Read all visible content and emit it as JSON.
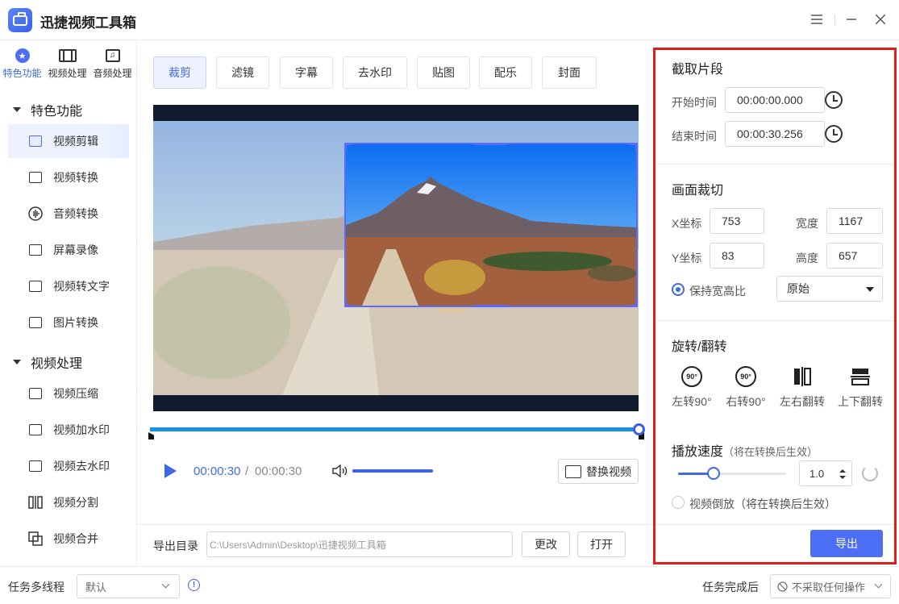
{
  "app": {
    "title": "迅捷视频工具箱",
    "window_controls": [
      "menu-icon",
      "minimize-icon",
      "close-icon"
    ]
  },
  "sidebar": {
    "mode_tabs": [
      {
        "label": "特色功能",
        "icon": "star-icon",
        "active": true
      },
      {
        "label": "视频处理",
        "icon": "film-icon",
        "active": false
      },
      {
        "label": "音频处理",
        "icon": "music-icon",
        "active": false
      }
    ],
    "groups": [
      {
        "title": "特色功能",
        "items": [
          {
            "label": "视频剪辑",
            "icon": "video-cut-icon",
            "active": true
          },
          {
            "label": "视频转换",
            "icon": "video-convert-icon",
            "active": false
          },
          {
            "label": "音频转换",
            "icon": "audio-convert-icon",
            "active": false
          },
          {
            "label": "屏幕录像",
            "icon": "screen-record-icon",
            "active": false
          },
          {
            "label": "视频转文字",
            "icon": "video-to-text-icon",
            "active": false
          },
          {
            "label": "图片转换",
            "icon": "image-convert-icon",
            "active": false
          }
        ]
      },
      {
        "title": "视频处理",
        "items": [
          {
            "label": "视频压缩",
            "icon": "video-compress-icon",
            "active": false
          },
          {
            "label": "视频加水印",
            "icon": "add-watermark-icon",
            "active": false
          },
          {
            "label": "视频去水印",
            "icon": "remove-watermark-icon",
            "active": false
          },
          {
            "label": "视频分割",
            "icon": "video-split-icon",
            "active": false
          },
          {
            "label": "视频合并",
            "icon": "video-merge-icon",
            "active": false
          }
        ]
      }
    ]
  },
  "editor": {
    "tabs": [
      {
        "label": "裁剪",
        "active": true
      },
      {
        "label": "滤镜",
        "active": false
      },
      {
        "label": "字幕",
        "active": false
      },
      {
        "label": "去水印",
        "active": false
      },
      {
        "label": "贴图",
        "active": false
      },
      {
        "label": "配乐",
        "active": false
      },
      {
        "label": "封面",
        "active": false
      }
    ],
    "player": {
      "current_time": "00:00:30",
      "separator": "/",
      "total_time": "00:00:30",
      "progress": 1.0,
      "volume": 1.0
    },
    "replace_button": "替换视频",
    "export": {
      "label": "导出目录",
      "path": "C:\\Users\\Admin\\Desktop\\迅捷视频工具箱",
      "change_button": "更改",
      "open_button": "打开"
    }
  },
  "right_panel": {
    "clip": {
      "title": "截取片段",
      "start_label": "开始时间",
      "start_value": "00:00:00.000",
      "end_label": "结束时间",
      "end_value": "00:00:30.256"
    },
    "crop": {
      "title": "画面裁切",
      "x_label": "X坐标",
      "x_value": "753",
      "width_label": "宽度",
      "width_value": "1167",
      "y_label": "Y坐标",
      "y_value": "83",
      "height_label": "高度",
      "height_value": "657",
      "keep_ratio_label": "保持宽高比",
      "keep_ratio_checked": true,
      "ratio_selected": "原始"
    },
    "rotate": {
      "title": "旋转/翻转",
      "items": [
        {
          "label": "左转90°",
          "icon": "rotate-left-90-icon",
          "glyph": "90°"
        },
        {
          "label": "右转90°",
          "icon": "rotate-right-90-icon",
          "glyph": "90°"
        },
        {
          "label": "左右翻转",
          "icon": "flip-horizontal-icon"
        },
        {
          "label": "上下翻转",
          "icon": "flip-vertical-icon"
        }
      ]
    },
    "speed": {
      "title": "播放速度",
      "note": "（将在转换后生效）",
      "value": "1.0",
      "slider_fraction": 0.33
    },
    "reverse": {
      "label": "视频倒放",
      "note": "（将在转换后生效）",
      "checked": false
    },
    "export_button": "导出"
  },
  "bottom": {
    "threads_label": "任务多线程",
    "threads_value": "默认",
    "after_label": "任务完成后",
    "after_value": "不采取任何操作"
  },
  "colors": {
    "accent": "#4c6ef5",
    "highlight_border": "#e01e1e",
    "progress": "#1a8fe8"
  }
}
